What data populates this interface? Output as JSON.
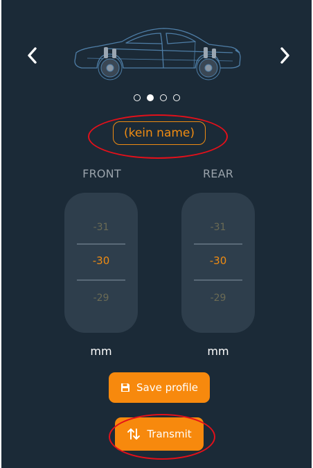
{
  "carousel": {
    "prev_icon": "chevron-left-icon",
    "next_icon": "chevron-right-icon",
    "image": "sedan-outline",
    "dots_count": 4,
    "active_dot": 2
  },
  "profile": {
    "name": "(kein name)"
  },
  "front": {
    "label": "FRONT",
    "prev": "-31",
    "value": "-30",
    "next": "-29",
    "unit": "mm"
  },
  "rear": {
    "label": "REAR",
    "prev": "-31",
    "value": "-30",
    "next": "-29",
    "unit": "mm"
  },
  "actions": {
    "save_label": "Save profile",
    "save_icon": "floppy-disk-icon",
    "transmit_label": "Transmit",
    "transmit_icon": "up-down-arrows-icon"
  },
  "colors": {
    "background": "#1b2a37",
    "accent": "#f7890d",
    "picker": "#2e3e4c",
    "annotation": "#e4101a"
  }
}
